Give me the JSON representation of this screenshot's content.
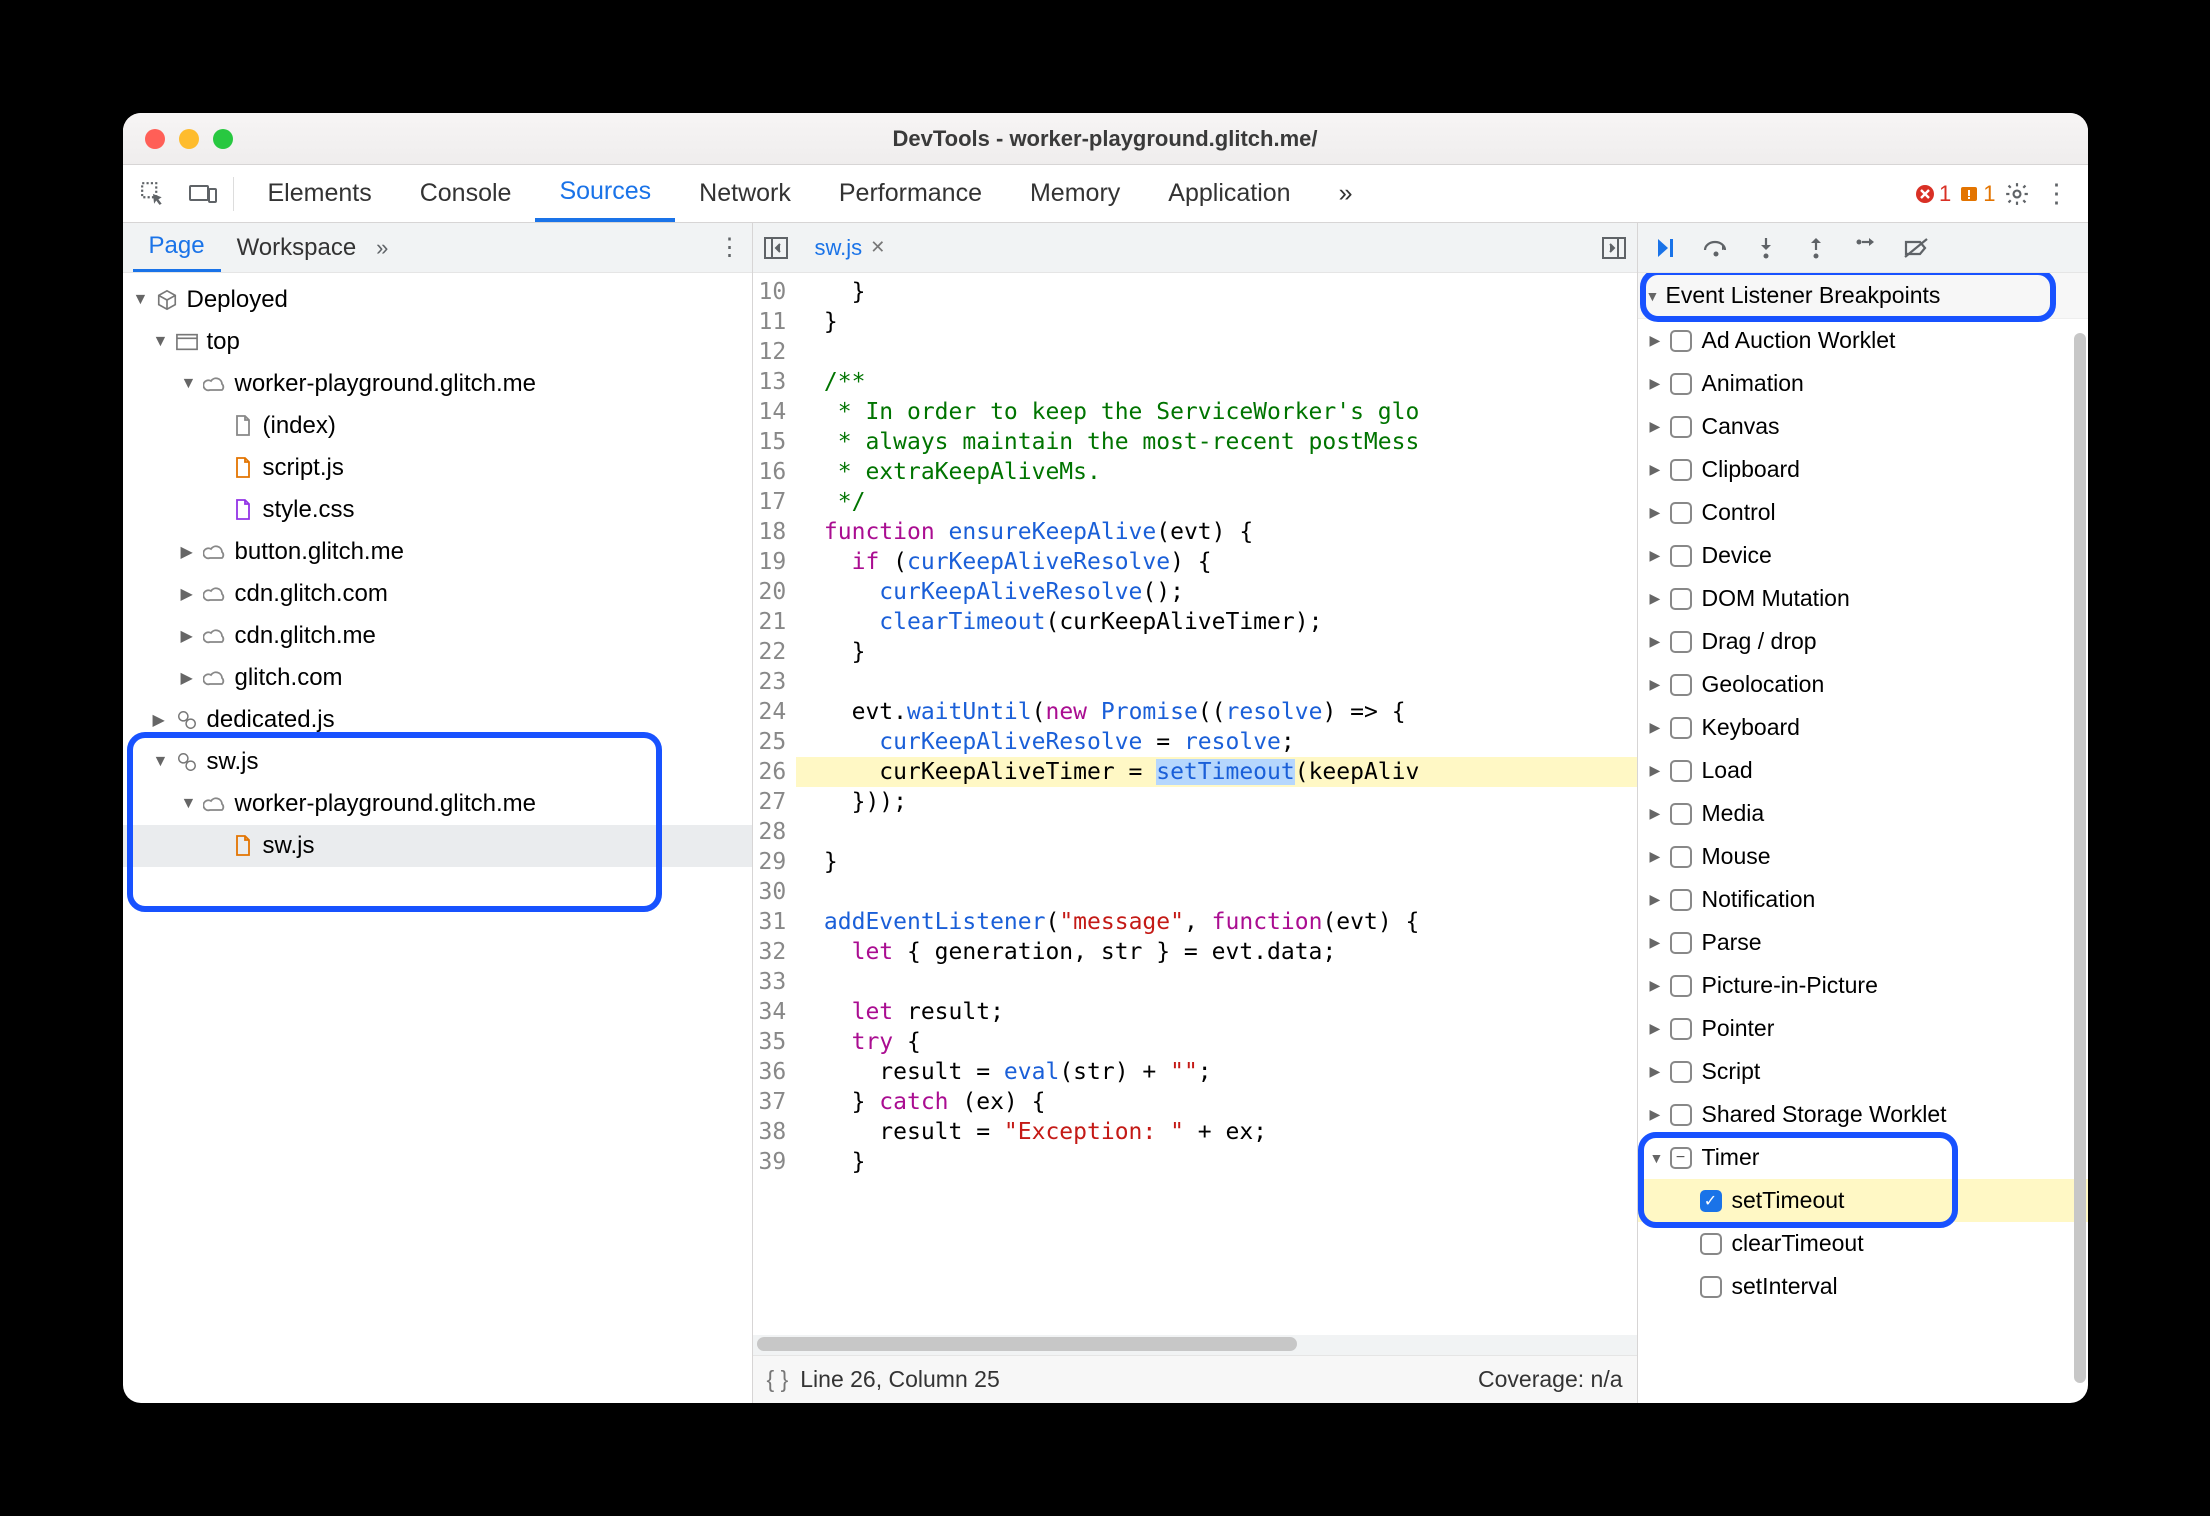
{
  "window": {
    "title": "DevTools - worker-playground.glitch.me/"
  },
  "toolbar": {
    "tabs": [
      "Elements",
      "Console",
      "Sources",
      "Network",
      "Performance",
      "Memory",
      "Application"
    ],
    "active": "Sources",
    "overflow": "»",
    "errors": "1",
    "warnings": "1"
  },
  "left": {
    "subtabs": [
      "Page",
      "Workspace"
    ],
    "active": "Page",
    "overflow": "»",
    "tree": {
      "deployed": "Deployed",
      "top": "top",
      "origin1": "worker-playground.glitch.me",
      "index": "(index)",
      "scriptjs": "script.js",
      "stylecss": "style.css",
      "button": "button.glitch.me",
      "cdn1": "cdn.glitch.com",
      "cdn2": "cdn.glitch.me",
      "glitch": "glitch.com",
      "dedicated": "dedicated.js",
      "sw_group": "sw.js",
      "origin2": "worker-playground.glitch.me",
      "swjs": "sw.js"
    }
  },
  "editor": {
    "filename": "sw.js",
    "first_line": 10,
    "lines": [
      "    }",
      "  }",
      "",
      "  /**",
      "   * In order to keep the ServiceWorker's glo",
      "   * always maintain the most-recent postMess",
      "   * extraKeepAliveMs.",
      "   */",
      "  function ensureKeepAlive(evt) {",
      "    if (curKeepAliveResolve) {",
      "      curKeepAliveResolve();",
      "      clearTimeout(curKeepAliveTimer);",
      "    }",
      "",
      "    evt.waitUntil(new Promise((resolve) => {",
      "      curKeepAliveResolve = resolve;",
      "      curKeepAliveTimer = setTimeout(keepAliv",
      "    }));",
      "",
      "  }",
      "",
      "  addEventListener(\"message\", function(evt) {",
      "    let { generation, str } = evt.data;",
      "",
      "    let result;",
      "    try {",
      "      result = eval(str) + \"\";",
      "    } catch (ex) {",
      "      result = \"Exception: \" + ex;",
      "    }"
    ],
    "status_line": "Line 26, Column 25",
    "coverage": "Coverage: n/a"
  },
  "right": {
    "section": "Event Listener Breakpoints",
    "categories": [
      "Ad Auction Worklet",
      "Animation",
      "Canvas",
      "Clipboard",
      "Control",
      "Device",
      "DOM Mutation",
      "Drag / drop",
      "Geolocation",
      "Keyboard",
      "Load",
      "Media",
      "Mouse",
      "Notification",
      "Parse",
      "Picture-in-Picture",
      "Pointer",
      "Script",
      "Shared Storage Worklet"
    ],
    "timer_label": "Timer",
    "timer_children": [
      "setTimeout",
      "clearTimeout",
      "setInterval"
    ]
  }
}
